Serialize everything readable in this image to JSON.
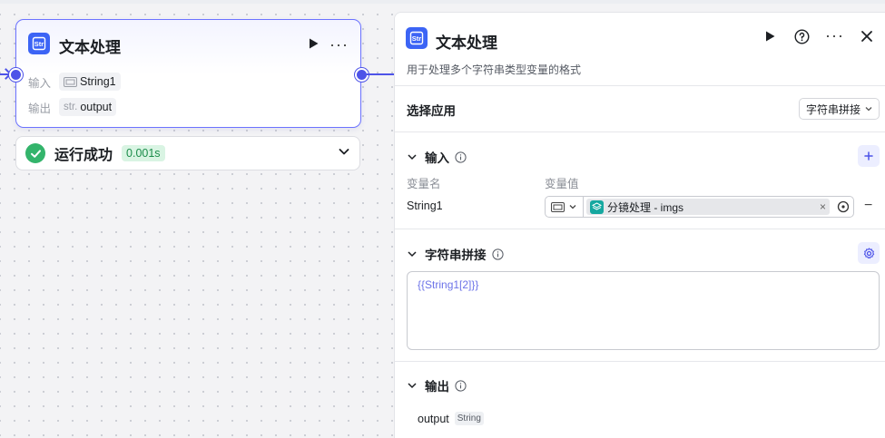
{
  "node": {
    "title": "文本处理",
    "input_label": "输入",
    "input_value": "String1",
    "output_label": "输出",
    "output_prefix": "str.",
    "output_value": "output"
  },
  "run_result": {
    "status": "运行成功",
    "time": "0.001s"
  },
  "panel": {
    "title": "文本处理",
    "description": "用于处理多个字符串类型变量的格式",
    "select_app_label": "选择应用",
    "select_app_value": "字符串拼接",
    "input_section": {
      "title": "输入",
      "col_name": "变量名",
      "col_value": "变量值",
      "rows": [
        {
          "name": "String1",
          "ref": "分镜处理 - imgs"
        }
      ]
    },
    "concat_section": {
      "title": "字符串拼接",
      "template": "{{String1[2]}}"
    },
    "output_section": {
      "title": "输出",
      "name": "output",
      "type": "String"
    }
  },
  "colors": {
    "accent": "#4d53e8",
    "node_icon": "#3c64f5",
    "success": "#33b46b",
    "ref_icon": "#16a8a0"
  }
}
